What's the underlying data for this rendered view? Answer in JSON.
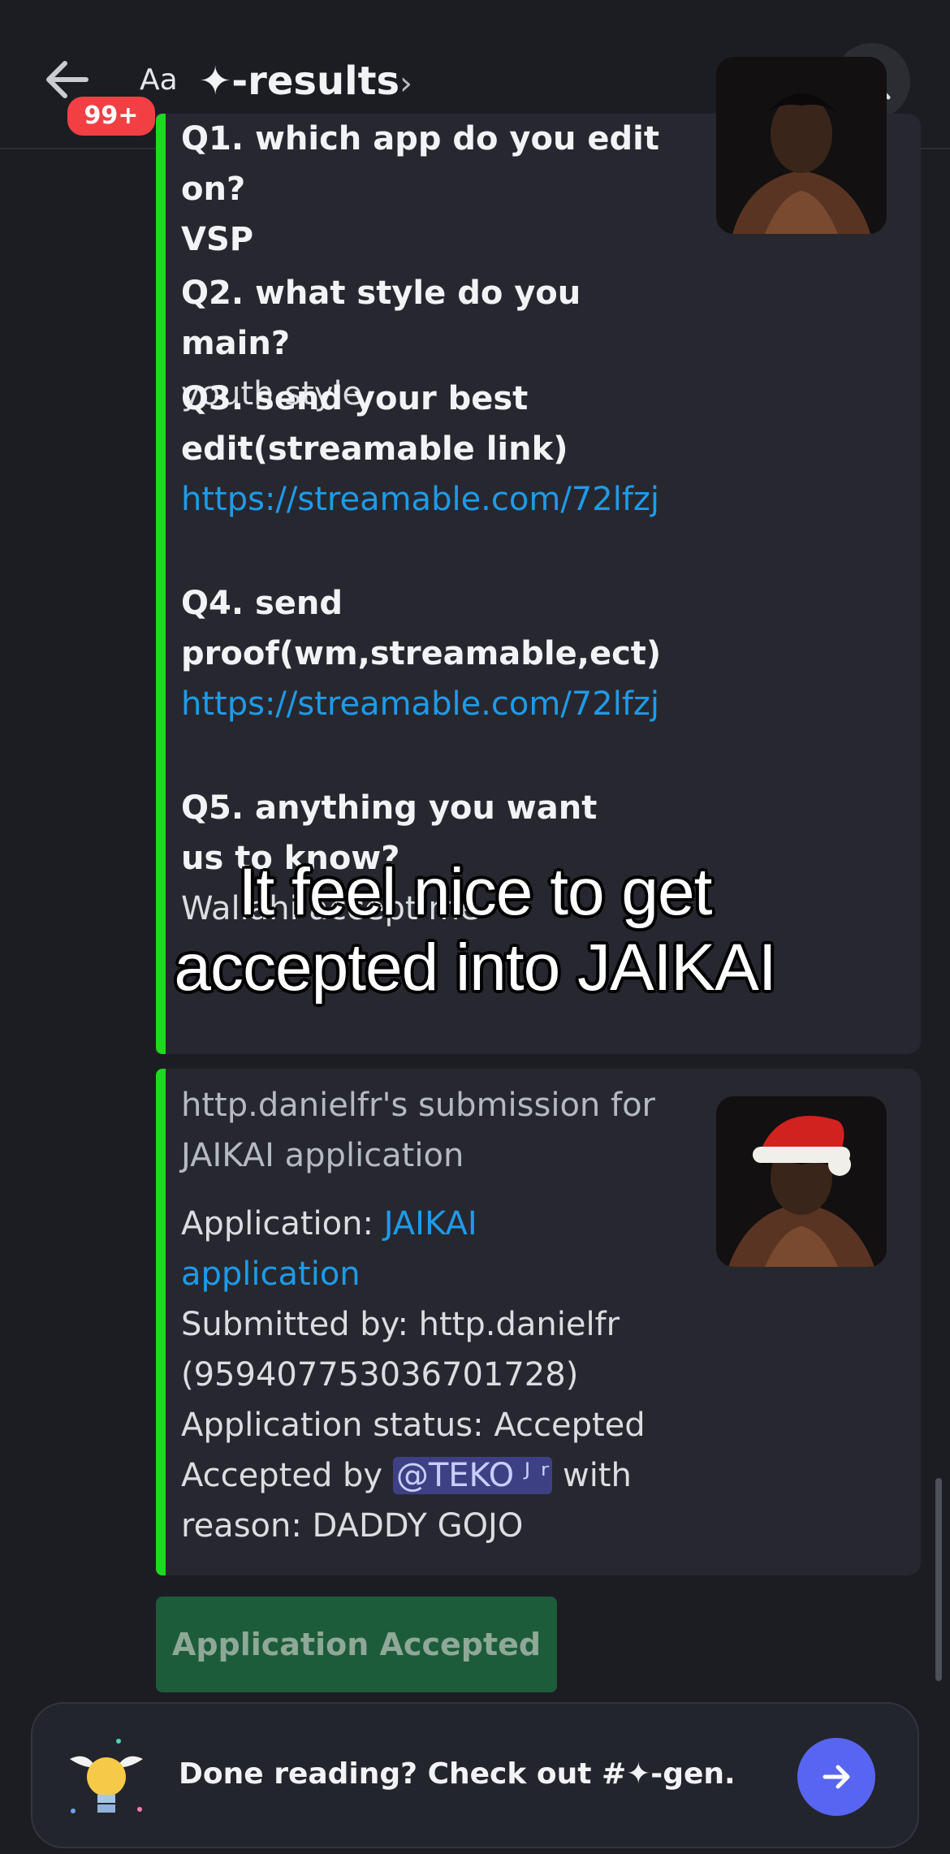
{
  "header": {
    "badge": "99+",
    "aa_label": "Aa",
    "channel_title": "✦-results",
    "chevron": "›"
  },
  "embed1": {
    "q1_label": "Q1. which app do you edit on?",
    "q1_answer": "VSP",
    "q2_label": "Q2. what style do you main?",
    "q2_answer": "youth style",
    "q3_label_line1": "Q3. send your best",
    "q3_label_line2": "edit(streamable link)",
    "q3_link": "https://streamable.com/72lfzj",
    "q4_label_line1": "Q4. send",
    "q4_label_line2": "proof(wm,streamable,ect)",
    "q4_link": "https://streamable.com/72lfzj",
    "q5_label": "Q5. anything you want us to know?",
    "q5_answer": "Wallahi accept me"
  },
  "embed2": {
    "title_line1": "http.danielfr's submission for",
    "title_line2": "JAIKAI application",
    "application_label": "Application: ",
    "application_link_line1": "JAIKAI",
    "application_link_line2": "application",
    "submitted_line1": "Submitted by: http.danielfr",
    "submitted_line2": "(959407753036701728)",
    "status": "Application status: Accepted",
    "accepted_by_prefix": "Accepted by ",
    "mention": "@TEKO ᴶ ʳ",
    "accepted_by_suffix": " with",
    "reason": "reason: DADDY GOJO"
  },
  "accept_button": "Application Accepted",
  "overlay": {
    "line1": "It feel nice to get",
    "line2": "accepted into JAIKAI"
  },
  "bottom_bar": {
    "text": "Done reading? Check out #✦-gen."
  },
  "colors": {
    "accent_green": "#1fd81f",
    "link_blue": "#1e9be9",
    "blurple": "#5865f2",
    "badge_red": "#f23f43"
  }
}
